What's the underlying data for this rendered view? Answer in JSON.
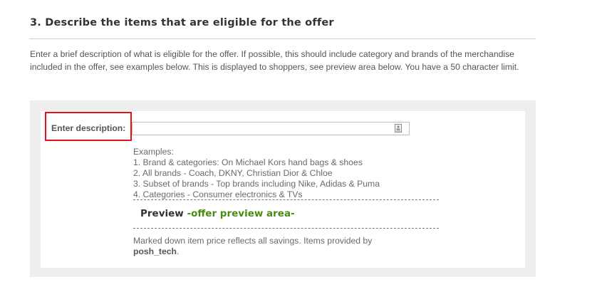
{
  "section": {
    "title": "3. Describe the items that are eligible for the offer",
    "instructions": "Enter a brief description of what is eligible for the offer. If possible, this should include category and brands of the merchandise included in the offer, see examples below. This is displayed to shoppers, see preview area below. You have a 50 character limit."
  },
  "form": {
    "description_label": "Enter description:",
    "description_value": "",
    "input_icon": "contact-card-icon"
  },
  "examples": {
    "heading": "Examples:",
    "items": [
      "1. Brand & categories: On Michael Kors hand bags & shoes",
      "2. All brands - Coach, DKNY, Christian Dior & Chloe",
      "3. Subset of brands - Top brands including Nike, Adidas & Puma",
      "4. Categories - Consumer electronics & TVs"
    ]
  },
  "preview": {
    "label": "Preview",
    "separator": " -",
    "area_text": "offer preview area-"
  },
  "footer": {
    "note": "Marked down item price reflects all savings. Items provided by",
    "provider": "posh_tech",
    "suffix": "."
  },
  "colors": {
    "highlight_border": "#e3111a",
    "preview_green": "#4a8a12",
    "panel_bg": "#eeeeee"
  }
}
